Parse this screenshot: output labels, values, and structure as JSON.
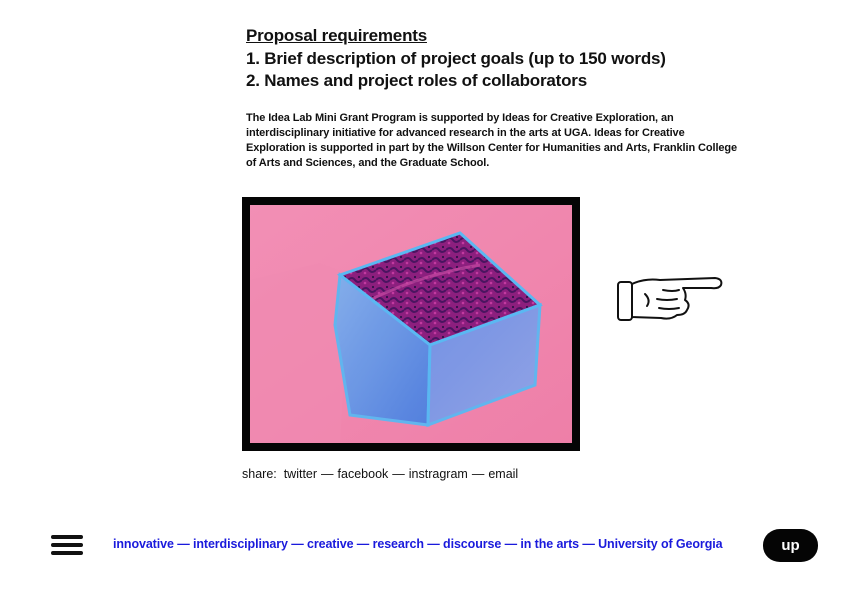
{
  "proposal": {
    "heading": "Proposal requirements",
    "items": [
      "1. Brief description of project goals (up to 150 words)",
      "2. Names and project roles of collaborators"
    ]
  },
  "support_text": "The Idea Lab Mini Grant Program is supported by Ideas for Creative Exploration, an interdisciplinary initiative for advanced research in the arts at UGA. Ideas for Creative Exploration is supported in part by the Willson Center for Humanities and Arts, Frank­lin College of Arts and Sciences, and the Graduate School.",
  "image": {
    "icon": "artwork-image",
    "bg_color": "#f08cb0",
    "frame_color": "#050505"
  },
  "pointer": {
    "icon": "pointing-hand-icon"
  },
  "share": {
    "label": "share:",
    "links": [
      "twitter",
      "facebook",
      "instragram",
      "email"
    ],
    "separator": "—"
  },
  "footer": {
    "menu_icon": "hamburger-menu-icon",
    "tagline": "innovative — interdisciplinary — creative — research — discourse  — in the arts — University of Georgia",
    "tagline_color": "#1a1adc",
    "up_label": "up"
  }
}
